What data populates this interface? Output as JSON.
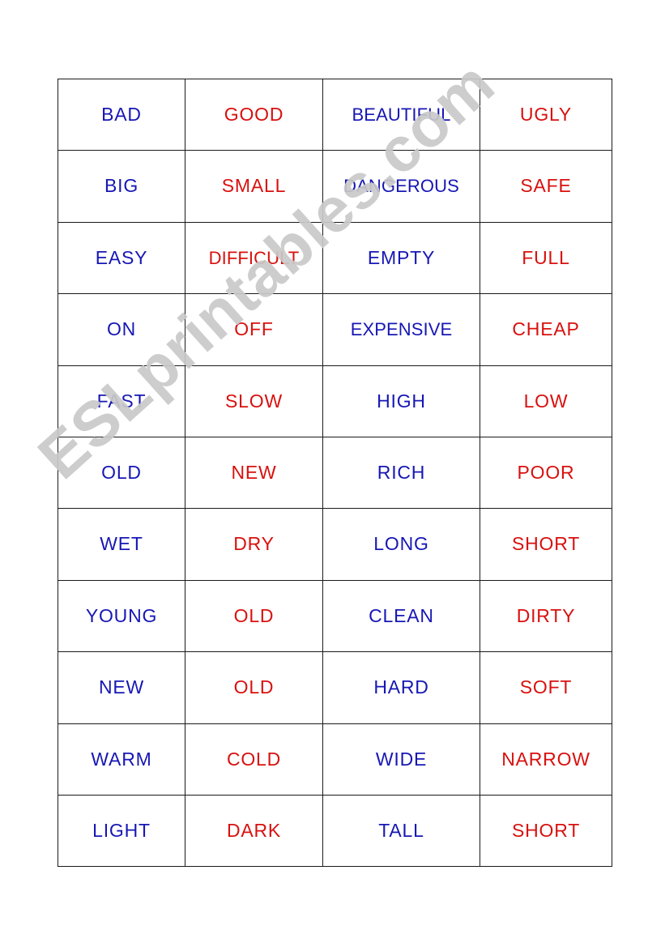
{
  "page": {
    "background_color": "#ffffff",
    "border_color": "#1a1a1a"
  },
  "watermark": {
    "text": "ESLprintables.com",
    "color": "#c9c9c9",
    "rotation_deg": -42
  },
  "colors": {
    "blue": "#1717b5",
    "red": "#d8110f"
  },
  "table": {
    "columns": 4,
    "rows": 11,
    "cells": [
      [
        {
          "text": "BAD",
          "color": "blue"
        },
        {
          "text": "GOOD",
          "color": "red"
        },
        {
          "text": "BEAUTIFUL",
          "color": "blue"
        },
        {
          "text": "UGLY",
          "color": "red"
        }
      ],
      [
        {
          "text": "BIG",
          "color": "blue"
        },
        {
          "text": "SMALL",
          "color": "red"
        },
        {
          "text": "DANGEROUS",
          "color": "blue"
        },
        {
          "text": "SAFE",
          "color": "red"
        }
      ],
      [
        {
          "text": "EASY",
          "color": "blue"
        },
        {
          "text": "DIFFICULT",
          "color": "red"
        },
        {
          "text": "EMPTY",
          "color": "blue"
        },
        {
          "text": "FULL",
          "color": "red"
        }
      ],
      [
        {
          "text": "ON",
          "color": "blue"
        },
        {
          "text": "OFF",
          "color": "red"
        },
        {
          "text": "EXPENSIVE",
          "color": "blue"
        },
        {
          "text": "CHEAP",
          "color": "red"
        }
      ],
      [
        {
          "text": "FAST",
          "color": "blue"
        },
        {
          "text": "SLOW",
          "color": "red"
        },
        {
          "text": "HIGH",
          "color": "blue"
        },
        {
          "text": "LOW",
          "color": "red"
        }
      ],
      [
        {
          "text": "OLD",
          "color": "blue"
        },
        {
          "text": "NEW",
          "color": "red"
        },
        {
          "text": "RICH",
          "color": "blue"
        },
        {
          "text": "POOR",
          "color": "red"
        }
      ],
      [
        {
          "text": "WET",
          "color": "blue"
        },
        {
          "text": "DRY",
          "color": "red"
        },
        {
          "text": "LONG",
          "color": "blue"
        },
        {
          "text": "SHORT",
          "color": "red"
        }
      ],
      [
        {
          "text": "YOUNG",
          "color": "blue"
        },
        {
          "text": "OLD",
          "color": "red"
        },
        {
          "text": "CLEAN",
          "color": "blue"
        },
        {
          "text": "DIRTY",
          "color": "red"
        }
      ],
      [
        {
          "text": "NEW",
          "color": "blue"
        },
        {
          "text": "OLD",
          "color": "red"
        },
        {
          "text": "HARD",
          "color": "blue"
        },
        {
          "text": "SOFT",
          "color": "red"
        }
      ],
      [
        {
          "text": "WARM",
          "color": "blue"
        },
        {
          "text": "COLD",
          "color": "red"
        },
        {
          "text": "WIDE",
          "color": "blue"
        },
        {
          "text": "NARROW",
          "color": "red"
        }
      ],
      [
        {
          "text": "LIGHT",
          "color": "blue"
        },
        {
          "text": "DARK",
          "color": "red"
        },
        {
          "text": "TALL",
          "color": "blue"
        },
        {
          "text": "SHORT",
          "color": "red"
        }
      ]
    ]
  }
}
